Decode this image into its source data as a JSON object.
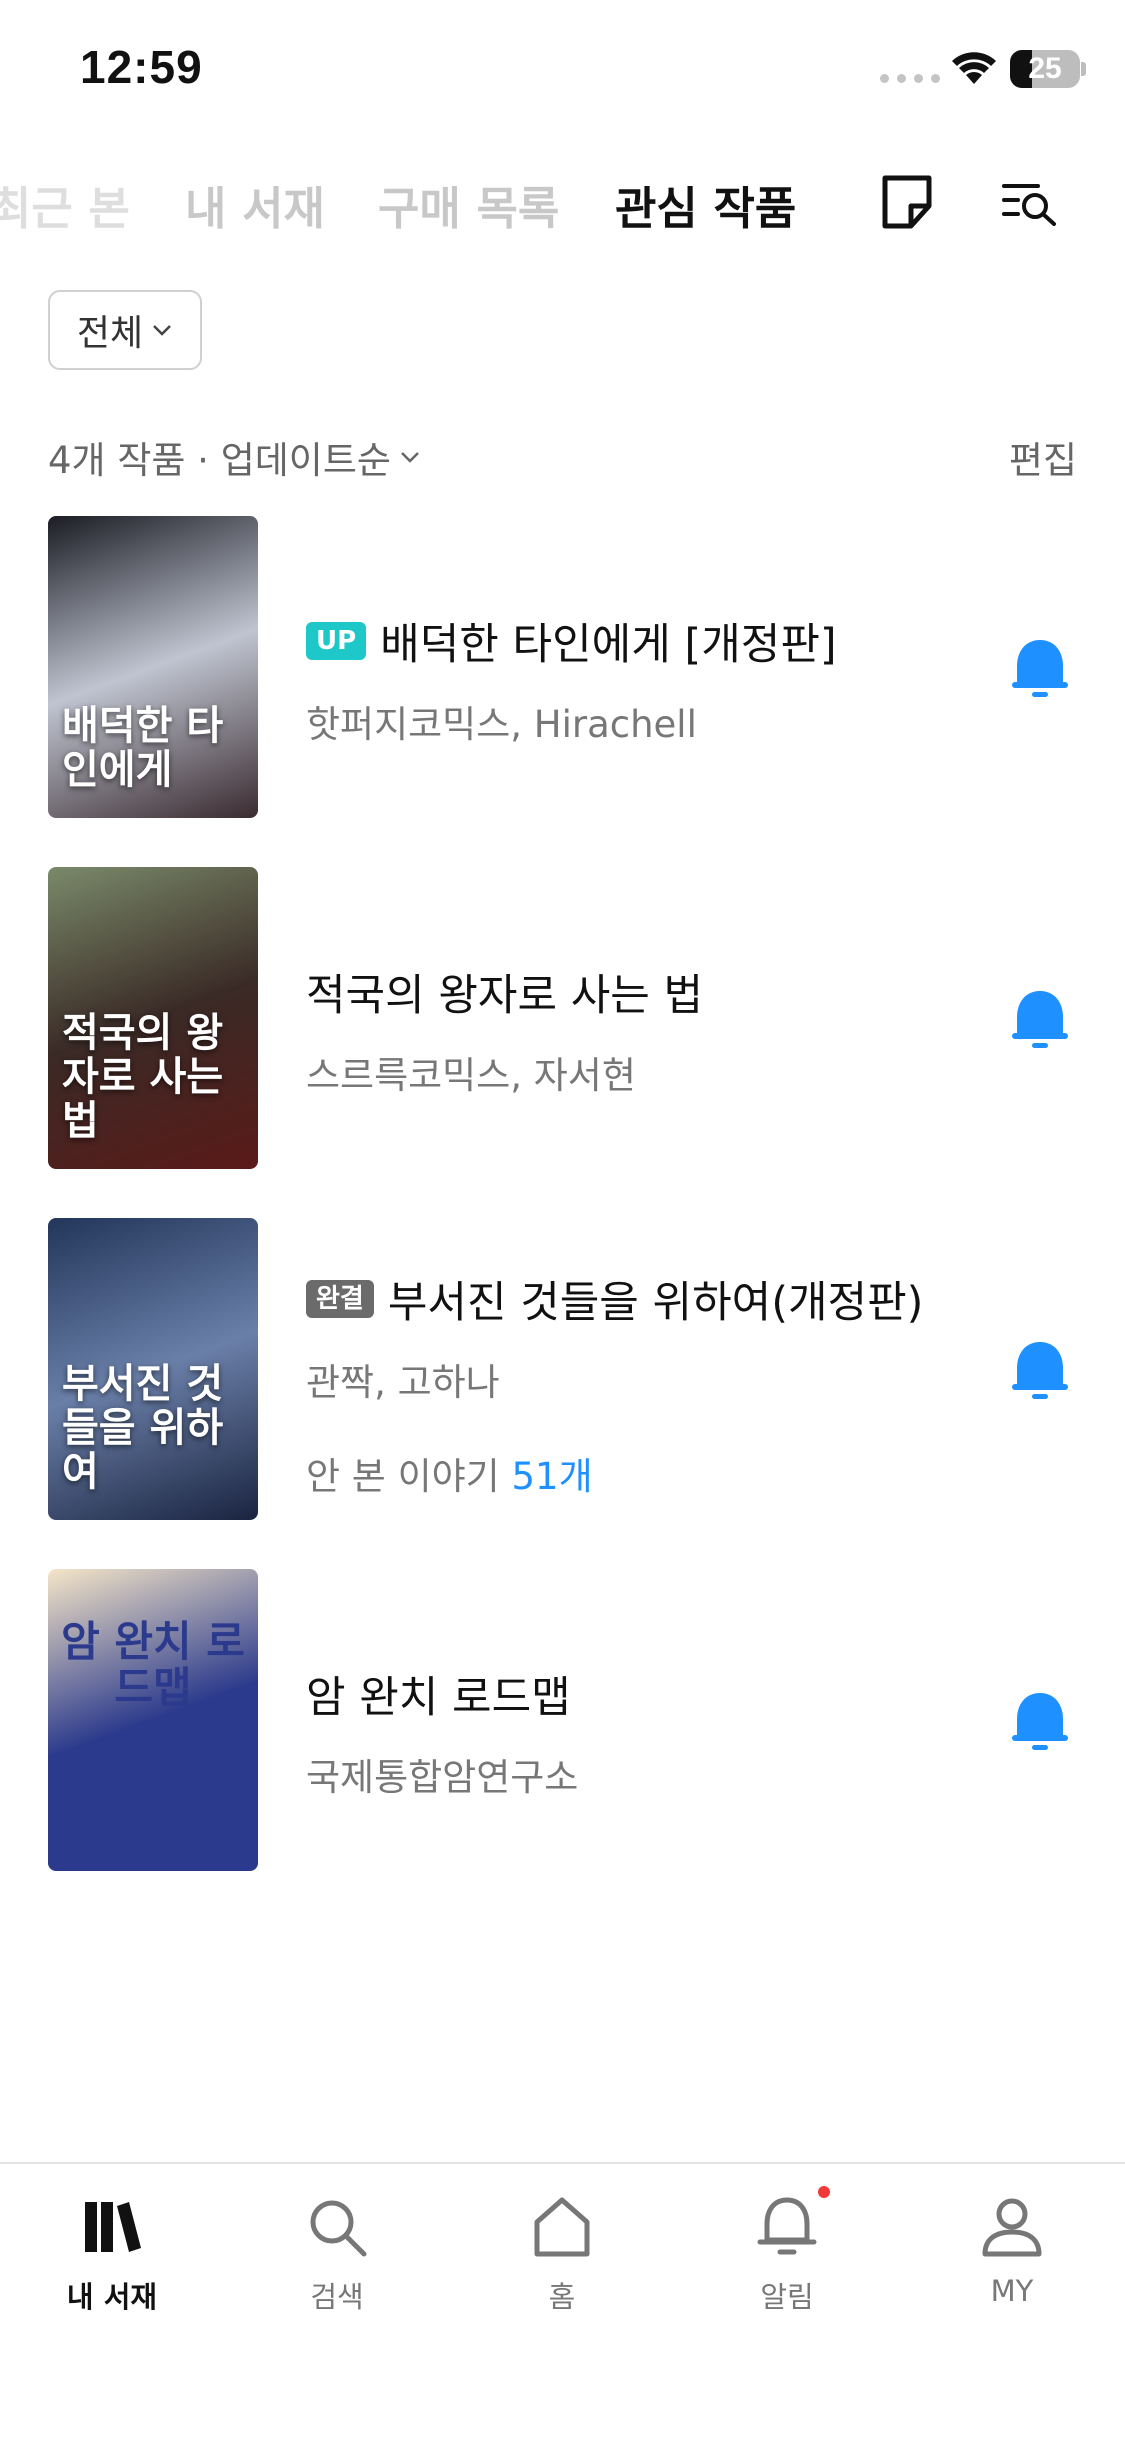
{
  "status_bar": {
    "time": "12:59",
    "battery": "25"
  },
  "tabs": [
    {
      "label": "최근 본",
      "active": false
    },
    {
      "label": "내 서재",
      "active": false
    },
    {
      "label": "구매 목록",
      "active": false
    },
    {
      "label": "관심 작품",
      "active": true
    }
  ],
  "header_icons": [
    "note-icon",
    "search-list-icon"
  ],
  "filter": {
    "label": "전체"
  },
  "list_header": {
    "summary": "4개 작품 · 업데이트순",
    "edit_label": "편집"
  },
  "items": [
    {
      "badge": "UP",
      "title": "배덕한 타인에게 [개정판]",
      "author": "핫퍼지코믹스, Hirachell",
      "cover_text": "배덕한 타인에게",
      "cover_colors": [
        "#1b1c24",
        "#bfc4d0",
        "#3a2b30"
      ]
    },
    {
      "badge": "",
      "title": "적국의 왕자로 사는 법",
      "author": "스르륵코믹스, 자서현",
      "cover_text": "적국의 왕자로 사는법",
      "cover_colors": [
        "#7a8a6a",
        "#3a2a26",
        "#5a1a18"
      ]
    },
    {
      "badge": "완결",
      "title": "부서진 것들을 위하여(개정판)",
      "author": "관짝, 고하나",
      "unread_label": "안 본 이야기",
      "unread_count": "51개",
      "cover_text": "부서진 것들을 위하여",
      "cover_colors": [
        "#22365a",
        "#6a7fa8",
        "#1a2440"
      ]
    },
    {
      "badge": "",
      "title": "암 완치 로드맵",
      "author": "국제통합암연구소",
      "cover_text": "암 완치 로드맵",
      "cover_colors": [
        "#f5e6c8",
        "#2b3a8c",
        "#2b3a8c"
      ]
    }
  ],
  "bottom_nav": [
    {
      "label": "내 서재",
      "icon": "library-icon",
      "active": true
    },
    {
      "label": "검색",
      "icon": "search-icon",
      "active": false
    },
    {
      "label": "홈",
      "icon": "home-icon",
      "active": false
    },
    {
      "label": "알림",
      "icon": "bell-icon",
      "active": false
    },
    {
      "label": "MY",
      "icon": "person-icon",
      "active": false
    }
  ],
  "colors": {
    "accent": "#1e90ff",
    "up_badge": "#1ec8c8",
    "done_badge": "#6b6b6b",
    "notification_dot": "#f03a3a"
  }
}
